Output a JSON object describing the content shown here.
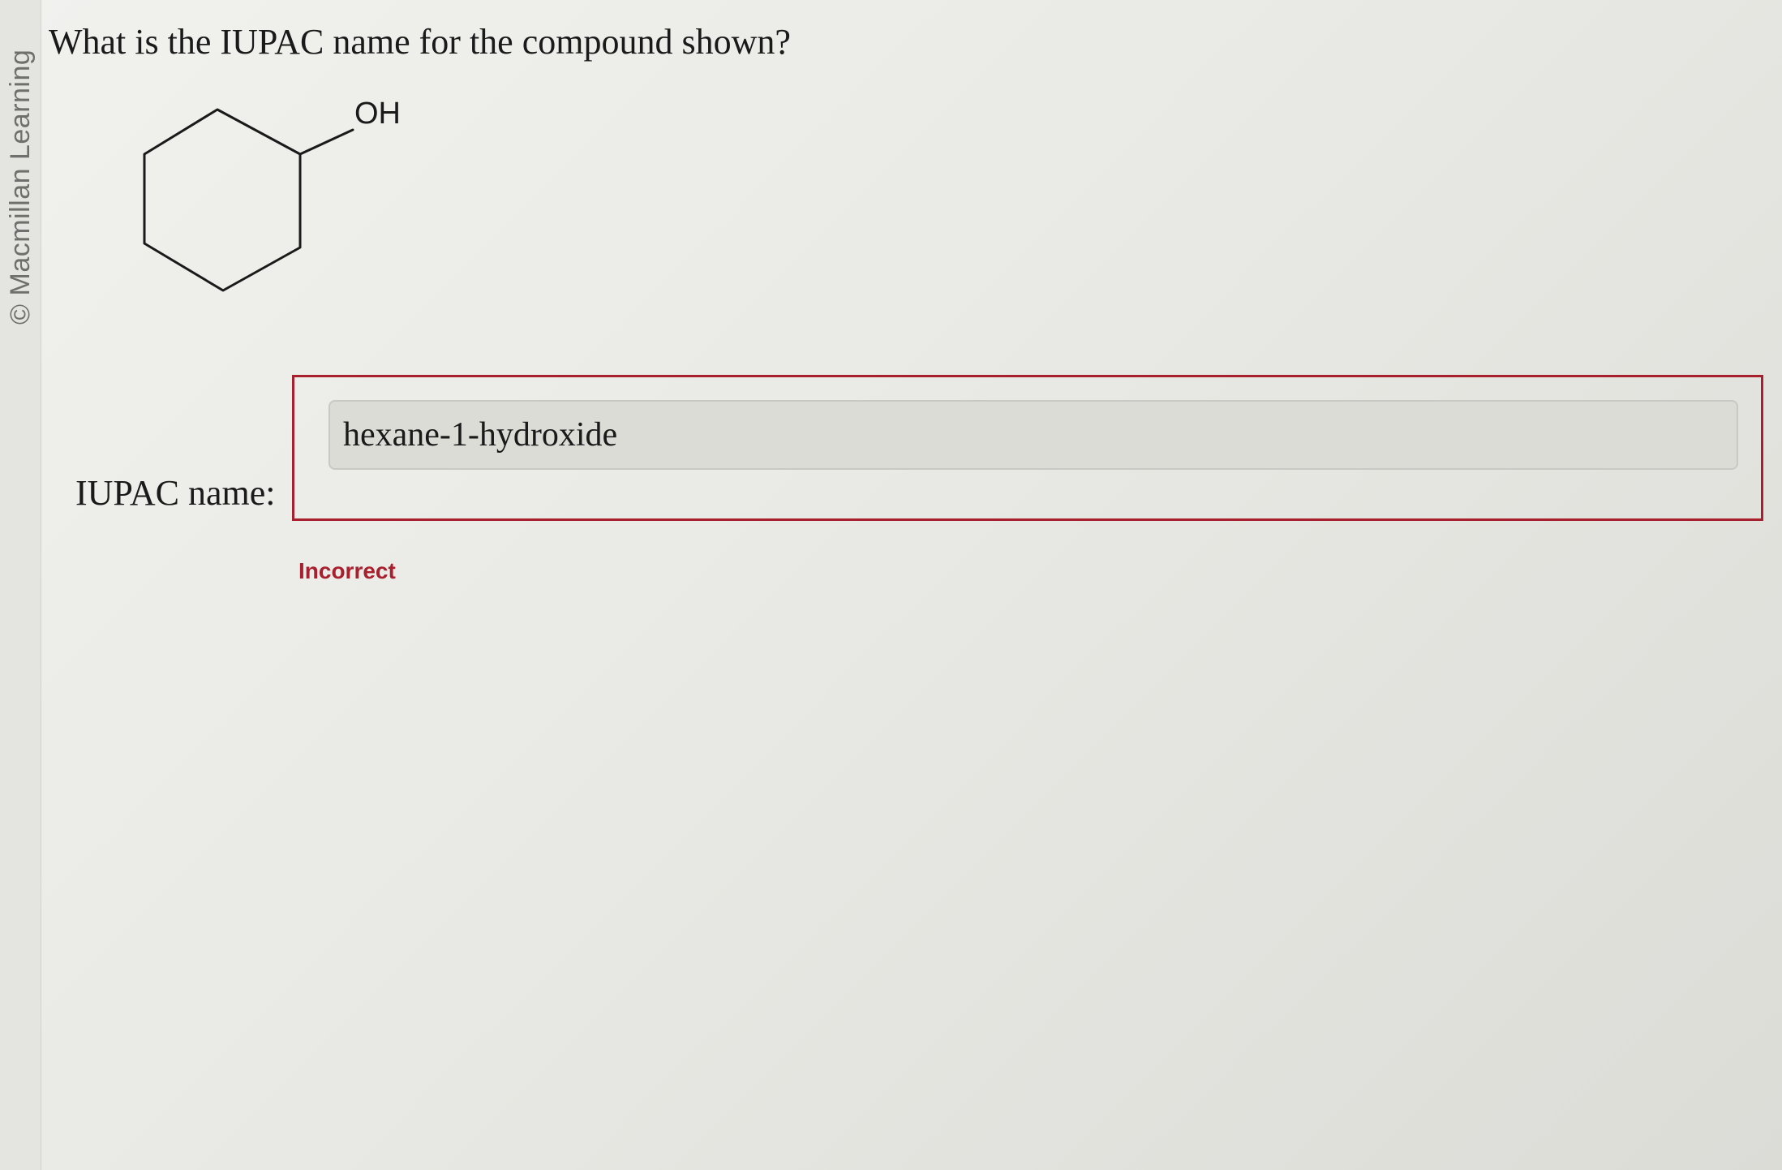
{
  "copyright": "© Macmillan Learning",
  "question": "What is the IUPAC name for the compound shown?",
  "molecule": {
    "substituent_label": "OH"
  },
  "answer": {
    "label": "IUPAC name:",
    "value": "hexane-1-hydroxide",
    "status": "Incorrect"
  },
  "colors": {
    "incorrect": "#a8202e",
    "input_background": "#dcdcd7",
    "text": "#1a1a1a"
  }
}
